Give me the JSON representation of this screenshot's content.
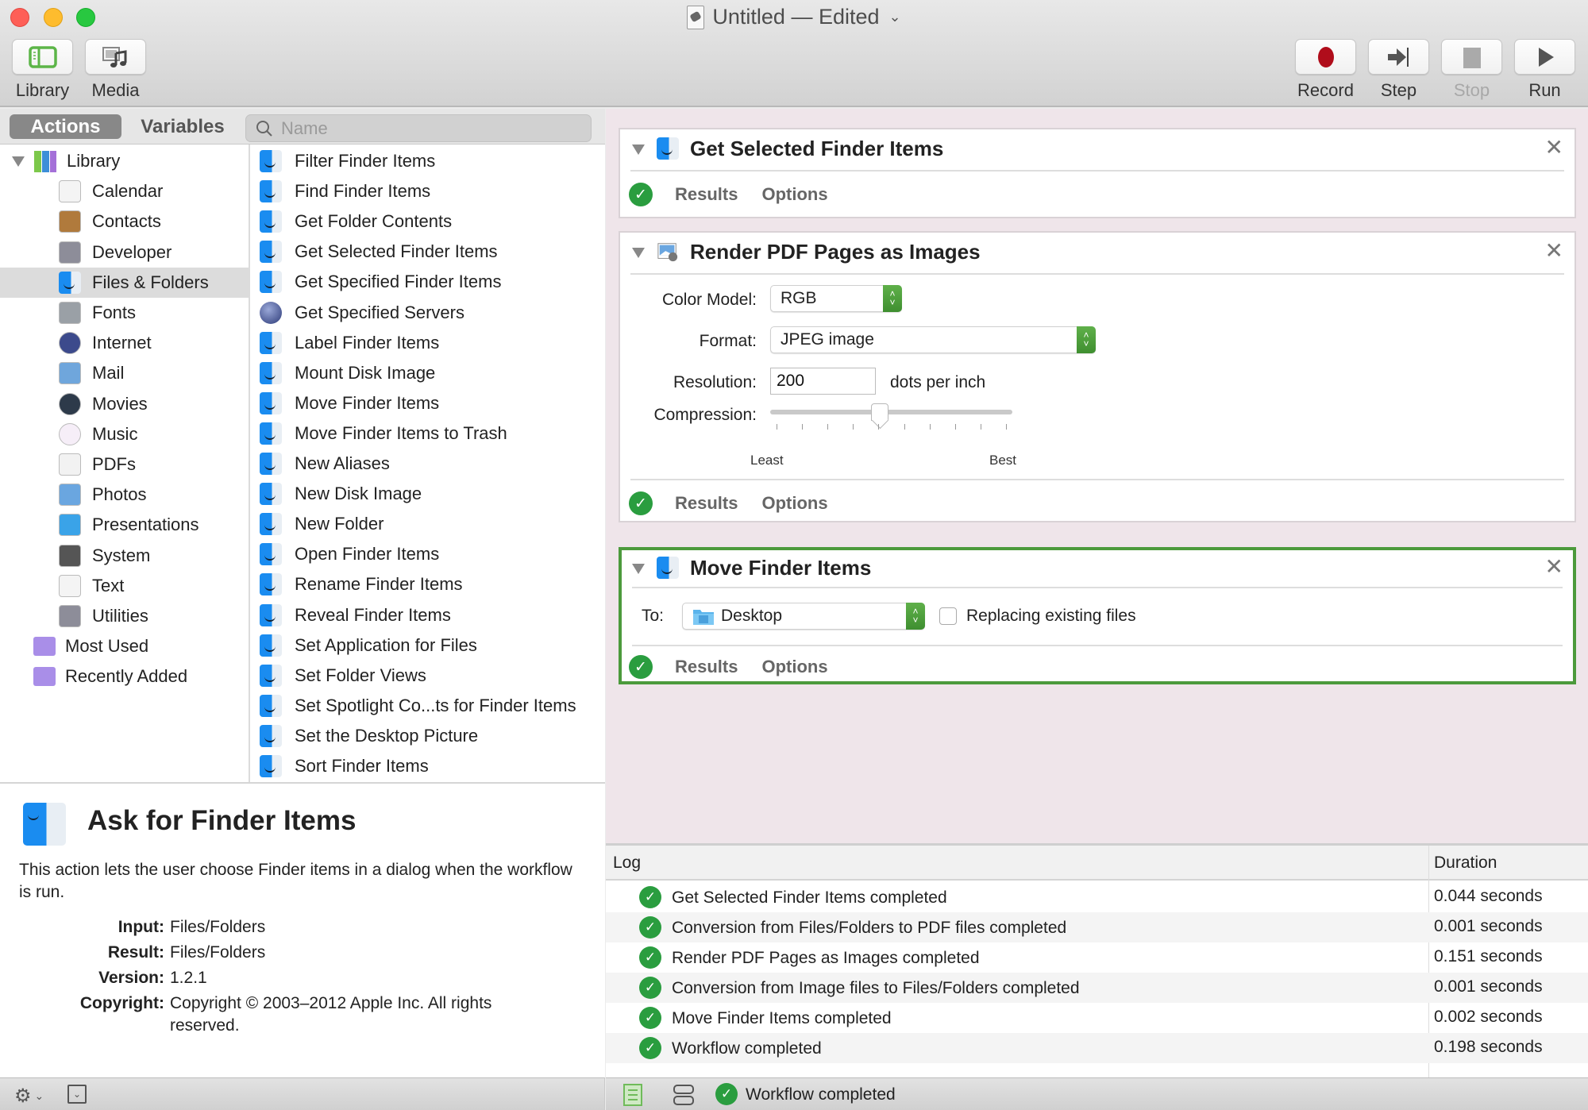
{
  "window": {
    "title": "Untitled — Edited",
    "title_chevron": "⌄"
  },
  "toolbar": {
    "left": [
      {
        "label": "Library",
        "icon": "library-icon"
      },
      {
        "label": "Media",
        "icon": "media-icon"
      }
    ],
    "right": [
      {
        "label": "Record",
        "icon": "record-icon",
        "enabled": true
      },
      {
        "label": "Step",
        "icon": "step-icon",
        "enabled": true
      },
      {
        "label": "Stop",
        "icon": "stop-icon",
        "enabled": false
      },
      {
        "label": "Run",
        "icon": "run-icon",
        "enabled": true
      }
    ]
  },
  "library_pane": {
    "tabs": [
      {
        "label": "Actions",
        "active": true
      },
      {
        "label": "Variables",
        "active": false
      }
    ],
    "search": {
      "placeholder": "Name",
      "value": ""
    },
    "tree_root": {
      "label": "Library",
      "expanded": true
    },
    "categories": [
      {
        "label": "Calendar",
        "icon": "calendar-icon"
      },
      {
        "label": "Contacts",
        "icon": "contacts-icon"
      },
      {
        "label": "Developer",
        "icon": "developer-icon"
      },
      {
        "label": "Files & Folders",
        "icon": "finder-icon",
        "selected": true
      },
      {
        "label": "Fonts",
        "icon": "fonts-icon"
      },
      {
        "label": "Internet",
        "icon": "internet-icon"
      },
      {
        "label": "Mail",
        "icon": "mail-icon"
      },
      {
        "label": "Movies",
        "icon": "movies-icon"
      },
      {
        "label": "Music",
        "icon": "music-icon"
      },
      {
        "label": "PDFs",
        "icon": "pdfs-icon"
      },
      {
        "label": "Photos",
        "icon": "photos-icon"
      },
      {
        "label": "Presentations",
        "icon": "presentations-icon"
      },
      {
        "label": "System",
        "icon": "system-icon"
      },
      {
        "label": "Text",
        "icon": "text-icon"
      },
      {
        "label": "Utilities",
        "icon": "utilities-icon"
      }
    ],
    "smart_folders": [
      {
        "label": "Most Used",
        "icon": "smart-folder-icon"
      },
      {
        "label": "Recently Added",
        "icon": "smart-folder-icon"
      }
    ],
    "actions": [
      {
        "label": "Filter Finder Items",
        "icon": "finder-icon"
      },
      {
        "label": "Find Finder Items",
        "icon": "finder-icon"
      },
      {
        "label": "Get Folder Contents",
        "icon": "finder-icon"
      },
      {
        "label": "Get Selected Finder Items",
        "icon": "finder-icon"
      },
      {
        "label": "Get Specified Finder Items",
        "icon": "finder-icon"
      },
      {
        "label": "Get Specified Servers",
        "icon": "globe-icon"
      },
      {
        "label": "Label Finder Items",
        "icon": "finder-icon"
      },
      {
        "label": "Mount Disk Image",
        "icon": "finder-icon"
      },
      {
        "label": "Move Finder Items",
        "icon": "finder-icon"
      },
      {
        "label": "Move Finder Items to Trash",
        "icon": "finder-icon"
      },
      {
        "label": "New Aliases",
        "icon": "finder-icon"
      },
      {
        "label": "New Disk Image",
        "icon": "finder-icon"
      },
      {
        "label": "New Folder",
        "icon": "finder-icon"
      },
      {
        "label": "Open Finder Items",
        "icon": "finder-icon"
      },
      {
        "label": "Rename Finder Items",
        "icon": "finder-icon"
      },
      {
        "label": "Reveal Finder Items",
        "icon": "finder-icon"
      },
      {
        "label": "Set Application for Files",
        "icon": "finder-icon"
      },
      {
        "label": "Set Folder Views",
        "icon": "finder-icon"
      },
      {
        "label": "Set Spotlight Co...ts for Finder Items",
        "icon": "finder-icon"
      },
      {
        "label": "Set the Desktop Picture",
        "icon": "finder-icon"
      },
      {
        "label": "Sort Finder Items",
        "icon": "finder-icon"
      }
    ]
  },
  "description": {
    "title": "Ask for Finder Items",
    "text": "This action lets the user choose Finder items in a dialog when the workflow is run.",
    "meta": [
      {
        "key": "Input:",
        "value": "Files/Folders"
      },
      {
        "key": "Result:",
        "value": "Files/Folders"
      },
      {
        "key": "Version:",
        "value": "1.2.1"
      },
      {
        "key": "Copyright:",
        "value": "Copyright © 2003–2012 Apple Inc.  All rights reserved."
      }
    ]
  },
  "workflow": {
    "actions": [
      {
        "title": "Get Selected Finder Items",
        "results_label": "Results",
        "options_label": "Options",
        "status": "completed"
      },
      {
        "title": "Render PDF Pages as Images",
        "color_model_label": "Color Model:",
        "color_model_value": "RGB",
        "format_label": "Format:",
        "format_value": "JPEG image",
        "resolution_label": "Resolution:",
        "resolution_value": "200",
        "resolution_unit": "dots per inch",
        "compression_label": "Compression:",
        "compression_min_label": "Least",
        "compression_max_label": "Best",
        "compression_level": 0.45,
        "compression_ticks": 10,
        "results_label": "Results",
        "options_label": "Options",
        "status": "completed"
      },
      {
        "title": "Move Finder Items",
        "to_label": "To:",
        "to_value": "Desktop",
        "replace_label": "Replacing existing files",
        "replace_checked": false,
        "results_label": "Results",
        "options_label": "Options",
        "status": "completed",
        "selected": true
      }
    ]
  },
  "log": {
    "col_log": "Log",
    "col_duration": "Duration",
    "rows": [
      {
        "message": "Get Selected Finder Items completed",
        "duration": "0.044 seconds"
      },
      {
        "message": "Conversion from Files/Folders to PDF files completed",
        "duration": "0.001 seconds"
      },
      {
        "message": "Render PDF Pages as Images completed",
        "duration": "0.151 seconds"
      },
      {
        "message": "Conversion from Image files to Files/Folders completed",
        "duration": "0.001 seconds"
      },
      {
        "message": "Move Finder Items completed",
        "duration": "0.002 seconds"
      },
      {
        "message": "Workflow completed",
        "duration": "0.198 seconds"
      }
    ]
  },
  "status_bar": {
    "text": "Workflow completed"
  },
  "colors": {
    "accent_green": "#4c9a3c",
    "success_green": "#2a9d3f",
    "record_red": "#b00d1b",
    "workflow_bg": "#efe5ea"
  }
}
